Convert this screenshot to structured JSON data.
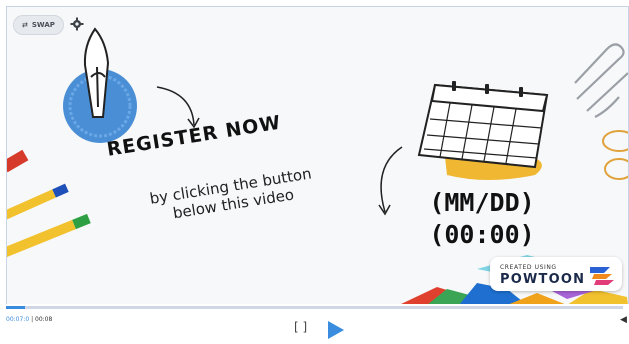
{
  "player": {
    "swap_label": "SWAP",
    "icons": [
      "swap-icon",
      "gear-icon",
      "fullscreen-icon",
      "play-icon",
      "volume-icon"
    ],
    "current_time": "00:07:0",
    "duration": "00:08",
    "progress_fraction": 0.03,
    "accent_color": "#3a8dde",
    "fullscreen_label": "[   ]"
  },
  "slide": {
    "headline": "REGISTER NOW",
    "subline_1": "by clicking the button",
    "subline_2": "below this video",
    "date_line": "(MM/DD)",
    "time_line": "(00:00)"
  },
  "brand": {
    "created_label": "CREATED USING",
    "name": "POWTOON"
  }
}
